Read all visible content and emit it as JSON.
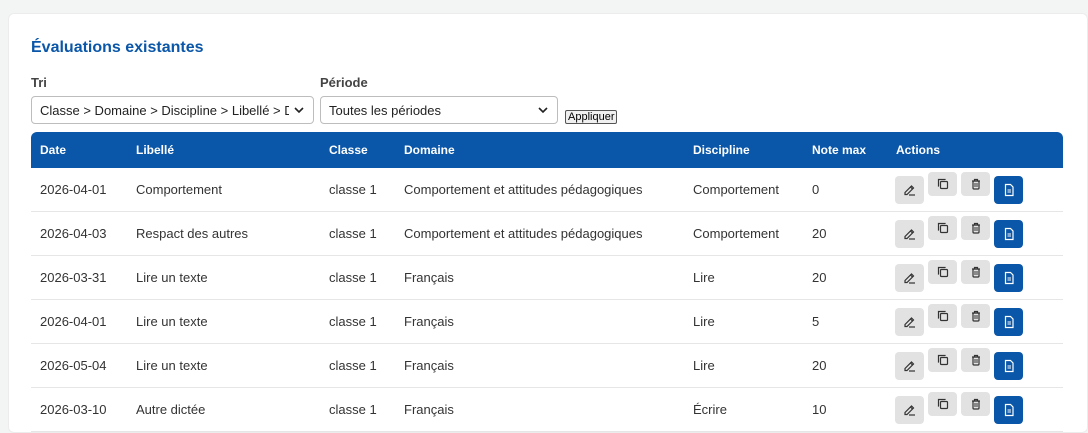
{
  "section_title": "Évaluations existantes",
  "filters": {
    "sort_label": "Tri",
    "sort_value": "Classe > Domaine > Discipline > Libellé > Date",
    "period_label": "Période",
    "period_value": "Toutes les périodes",
    "apply_label": "Appliquer"
  },
  "table": {
    "headers": [
      "Date",
      "Libellé",
      "Classe",
      "Domaine",
      "Discipline",
      "Note max",
      "Actions"
    ],
    "rows": [
      {
        "date": "2026-04-01",
        "libelle": "Comportement",
        "classe": "classe 1",
        "domaine": "Comportement et attitudes pédagogiques",
        "discipline": "Comportement",
        "note_max": "0"
      },
      {
        "date": "2026-04-03",
        "libelle": "Respact des autres",
        "classe": "classe 1",
        "domaine": "Comportement et attitudes pédagogiques",
        "discipline": "Comportement",
        "note_max": "20"
      },
      {
        "date": "2026-03-31",
        "libelle": "Lire un texte",
        "classe": "classe 1",
        "domaine": "Français",
        "discipline": "Lire",
        "note_max": "20"
      },
      {
        "date": "2026-04-01",
        "libelle": "Lire un texte",
        "classe": "classe 1",
        "domaine": "Français",
        "discipline": "Lire",
        "note_max": "5"
      },
      {
        "date": "2026-05-04",
        "libelle": "Lire un texte",
        "classe": "classe 1",
        "domaine": "Français",
        "discipline": "Lire",
        "note_max": "20"
      },
      {
        "date": "2026-03-10",
        "libelle": "Autre dictée",
        "classe": "classe 1",
        "domaine": "Français",
        "discipline": "Écrire",
        "note_max": "10"
      }
    ]
  },
  "icons": {
    "edit": "edit-icon",
    "duplicate": "copy-icon",
    "delete": "trash-icon",
    "report": "document-icon"
  },
  "colors": {
    "accent": "#0a56a8",
    "header_bg": "#0a56a8",
    "button_bg": "#e2e2e2",
    "page_bg": "#f3f4f4"
  }
}
